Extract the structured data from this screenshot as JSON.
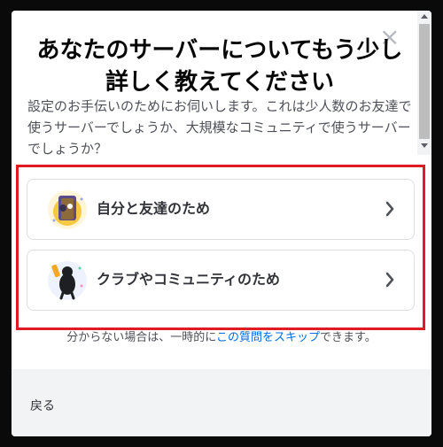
{
  "dialog": {
    "title": "あなたのサーバーについてもう少し詳しく教えてください",
    "subtitle": "設定のお手伝いのためにお伺いします。これは少人数のお友達で使うサーバーでしょうか、大規模なコミュニティで使うサーバーでしょうか？",
    "close_icon": "×"
  },
  "options": [
    {
      "label": "自分と友達のため",
      "icon": "friends-illustration-icon"
    },
    {
      "label": "クラブやコミュニティのため",
      "icon": "community-illustration-icon"
    }
  ],
  "skip": {
    "prefix": "分からない場合は、一時的に",
    "link": "この質問をスキップ",
    "suffix": "できます。"
  },
  "footer": {
    "back_label": "戻る"
  },
  "colors": {
    "highlight": "#e01b24",
    "link": "#006ce7",
    "footer_bg": "#f2f3f5"
  }
}
